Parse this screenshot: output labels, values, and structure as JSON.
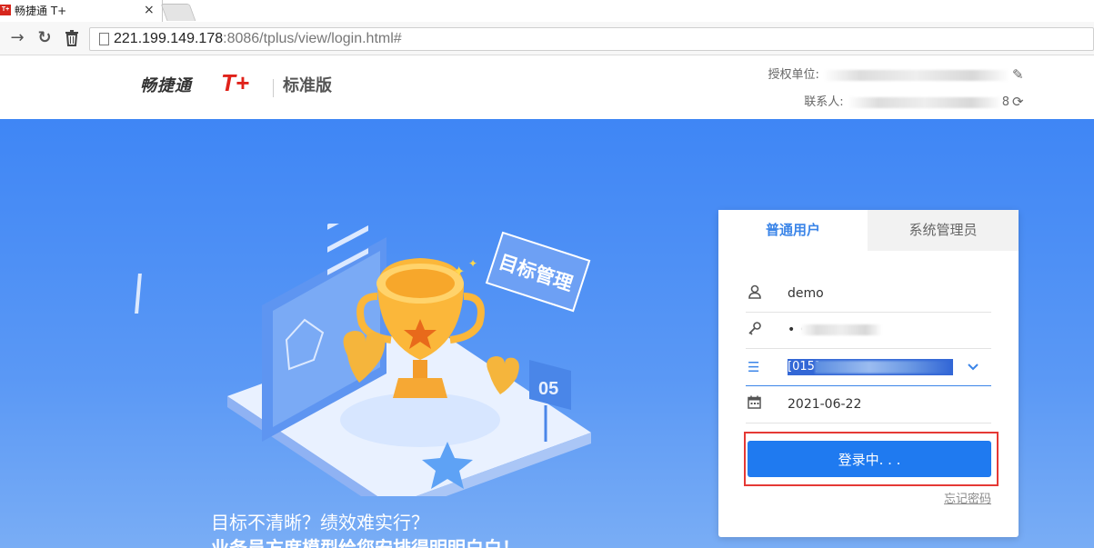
{
  "browser": {
    "tab_title": "畅捷通 T+",
    "favicon_text": "T+",
    "close_glyph": "×",
    "url_host": "221.199.149.178",
    "url_rest": ":8086/tplus/view/login.html#"
  },
  "header": {
    "brand_name": "畅捷通",
    "brand_t": "T+",
    "edition": "标准版",
    "license_label": "授权单位:",
    "contact_label": "联系人:",
    "contact_tail": "8"
  },
  "hero": {
    "badge_text": "目标管理",
    "flag_number": "05",
    "slogan_line1": "目标不清晰？绩效难实行？",
    "slogan_line2": "业务员方度模型给您安排得明明白白！"
  },
  "login": {
    "tab_user": "普通用户",
    "tab_admin": "系统管理员",
    "username": "demo",
    "password_visible": "• •",
    "account_prefix": "[015]",
    "date": "2021-06-22",
    "login_button": "登录中. . .",
    "forgot_password": "忘记密码"
  },
  "colors": {
    "accent": "#1f7af0",
    "brand_red": "#e0221a",
    "hero_bg": "#3f86f5",
    "highlight_box": "#e53935"
  },
  "icons": {
    "back": "arrow-right-icon",
    "reload": "reload-icon",
    "delete": "trash-icon",
    "user": "user-icon",
    "password": "key-icon",
    "account": "list-icon",
    "date": "calendar-icon",
    "edit": "pencil-icon",
    "refresh": "refresh-icon"
  }
}
